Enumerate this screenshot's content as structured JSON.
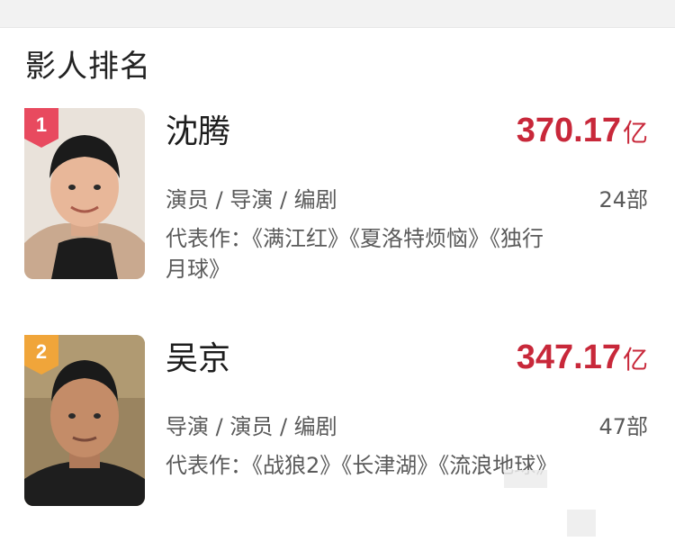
{
  "section": {
    "title": "影人排名"
  },
  "rankings": [
    {
      "rank": "1",
      "name": "沈腾",
      "box_office": "370.17",
      "box_unit": "亿",
      "roles": "演员 / 导演 / 编剧",
      "works_count": "24部",
      "representative_works": "代表作：《满江红》《夏洛特烦恼》《独行月球》",
      "badge_color": "#e84a5f",
      "avatar": "person-photo"
    },
    {
      "rank": "2",
      "name": "吴京",
      "box_office": "347.17",
      "box_unit": "亿",
      "roles": "导演 / 演员 / 编剧",
      "works_count": "47部",
      "representative_works": "代表作：《战狼2》《长津湖》《流浪地球》",
      "badge_color": "#f0a53a",
      "avatar": "person-photo"
    }
  ],
  "colors": {
    "box_office": "#c8283a",
    "text_secondary": "#5a5a5a"
  }
}
